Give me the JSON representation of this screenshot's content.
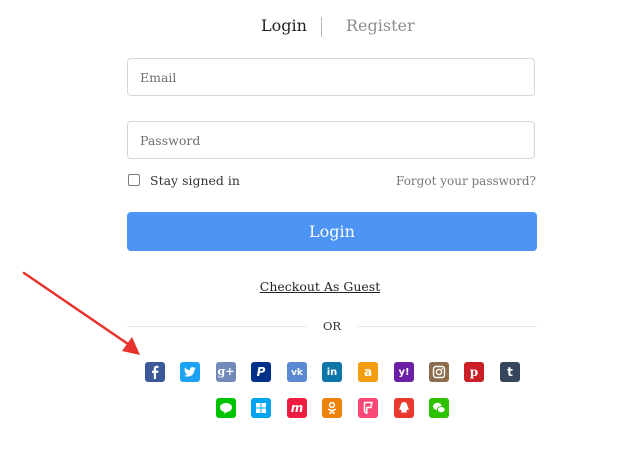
{
  "tabs": {
    "login": "Login",
    "register": "Register"
  },
  "form": {
    "email_placeholder": "Email",
    "password_placeholder": "Password",
    "remember_label": "Stay signed in",
    "remember_checked": false,
    "forgot_link": "Forgot your password?",
    "login_button": "Login",
    "guest_link": "Checkout As Guest",
    "divider_text": "OR"
  },
  "colors": {
    "primary": "#4d94f5",
    "arrow": "#e8322c"
  },
  "social_row1": [
    {
      "icon": "facebook-icon",
      "color": "#3b5998"
    },
    {
      "icon": "twitter-icon",
      "color": "#1da1f2"
    },
    {
      "icon": "google-plus-icon",
      "color": "#738ab8"
    },
    {
      "icon": "paypal-icon",
      "color": "#003087"
    },
    {
      "icon": "vk-icon",
      "color": "#5b8ad2"
    },
    {
      "icon": "linkedin-icon",
      "color": "#0e76a8"
    },
    {
      "icon": "amazon-icon",
      "color": "#f39c12"
    },
    {
      "icon": "yahoo-icon",
      "color": "#6b1ea6"
    },
    {
      "icon": "instagram-icon",
      "color": "#8b6d4c"
    },
    {
      "icon": "pinterest-icon",
      "color": "#cb2027"
    },
    {
      "icon": "tumblr-icon",
      "color": "#35465c"
    }
  ],
  "social_row2": [
    {
      "icon": "line-icon",
      "color": "#00c300"
    },
    {
      "icon": "windows-icon",
      "color": "#00a4ef"
    },
    {
      "icon": "meetup-icon",
      "color": "#ed1c40"
    },
    {
      "icon": "odnoklassniki-icon",
      "color": "#ee8208"
    },
    {
      "icon": "foursquare-icon",
      "color": "#f94877"
    },
    {
      "icon": "qq-icon",
      "color": "#eb3b2f"
    },
    {
      "icon": "wechat-icon",
      "color": "#2dc100"
    }
  ]
}
